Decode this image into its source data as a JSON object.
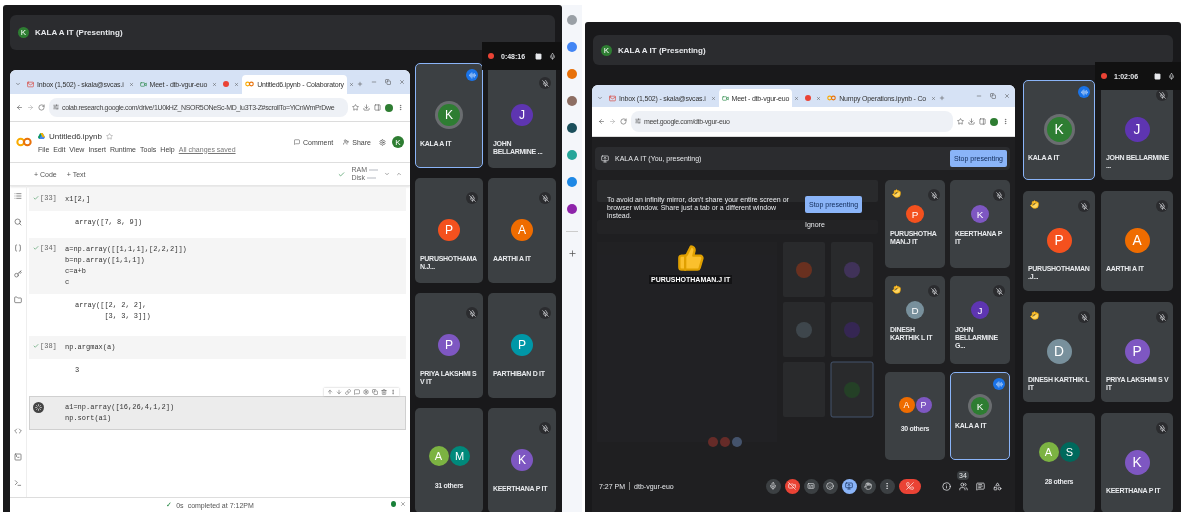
{
  "screens": [
    {
      "kind": "colab",
      "header": {
        "avatar": "K",
        "title": "KALA A IT (Presenting)"
      },
      "recording": {
        "time": "0:48:16"
      },
      "browser": {
        "tabs": [
          {
            "kind": "mail",
            "title": "Inbox (1,502) - skala@svcas.i",
            "selected": false
          },
          {
            "kind": "meet",
            "title": "Meet - dtb-vgur-euo",
            "selected": false
          },
          {
            "kind": "recording",
            "selected": false
          },
          {
            "kind": "colab",
            "title": "Untitled6.ipynb - Colaboratory",
            "selected": true
          }
        ],
        "url": "colab.research.google.com/drive/1U0kHZ_NSOR5ONeSc-MD_lu3T3-Z#scrollTo=YiCnWmPrDwe"
      },
      "notebook": {
        "name": "Untitled6.ipynb",
        "menu": [
          "File",
          "Edit",
          "View",
          "Insert",
          "Runtime",
          "Tools",
          "Help"
        ],
        "save_status": "All changes saved",
        "actions": [
          {
            "kind": "comment",
            "label": "Comment"
          },
          {
            "kind": "share",
            "label": "Share"
          }
        ],
        "avatar": "K",
        "toolbar": [
          "+ Code",
          "+ Text"
        ],
        "resources": [
          "RAM",
          "Disk"
        ],
        "cells": [
          {
            "number": "[33]",
            "active": false,
            "code": [
              "x1[2,]"
            ],
            "output": [
              "array([7, 8, 9])"
            ]
          },
          {
            "number": "[34]",
            "active": false,
            "code": [
              "a=np.array([[1,1,1],[2,2,2]])",
              "b=np.array([1,1,1])",
              "c=a+b",
              "c"
            ],
            "output": [
              "array([[2, 2, 2],",
              "       [3, 3, 3]])"
            ]
          },
          {
            "number": "[38]",
            "active": false,
            "code": [
              "np.argmax(a)"
            ],
            "output": [
              "3"
            ]
          },
          {
            "active": true,
            "code": [
              "a1=np.array([16,26,4,1,2])",
              "np.sort(a1)"
            ]
          }
        ],
        "status": {
          "check": "✓",
          "duration": "0s",
          "text": "completed at 7:12PM"
        }
      },
      "tiles": [
        {
          "kind": "person",
          "name": "KALA A IT",
          "initial": "K",
          "color": "#2e7d32",
          "speaking": true,
          "muted": false,
          "hand_raised": false
        },
        {
          "kind": "person",
          "name": "JOHN BELLARMINE ...",
          "initial": "J",
          "color": "#5e35b1",
          "speaking": false,
          "muted": true,
          "hand_raised": false
        },
        {
          "kind": "person",
          "name": "PURUSHOTHAMAN.J...",
          "initial": "P",
          "color": "#f4511e",
          "speaking": false,
          "muted": true,
          "hand_raised": false
        },
        {
          "kind": "person",
          "name": "AARTHI A IT",
          "initial": "A",
          "color": "#ef6c00",
          "speaking": false,
          "muted": true,
          "hand_raised": false
        },
        {
          "kind": "person",
          "name": "PRIYA LAKSHMI S V IT",
          "initial": "P",
          "color": "#7e57c2",
          "speaking": false,
          "muted": true,
          "hand_raised": false
        },
        {
          "kind": "person",
          "name": "PARTHIBAN D IT",
          "initial": "P",
          "color": "#0097a7",
          "speaking": false,
          "muted": true,
          "hand_raised": false
        },
        {
          "kind": "others",
          "label": "31 others",
          "avatars": [
            {
              "initial": "A",
              "color": "#7cb342"
            },
            {
              "initial": "M",
              "color": "#00897b"
            }
          ]
        },
        {
          "kind": "person",
          "name": "KEERTHANA P IT",
          "initial": "K",
          "color": "#7e57c2",
          "speaking": false,
          "muted": true,
          "hand_raised": false
        }
      ]
    },
    {
      "kind": "meet",
      "header": {
        "avatar": "K",
        "title": "KALA A IT (Presenting)"
      },
      "recording": {
        "time": "1:02:06"
      },
      "browser": {
        "tabs": [
          {
            "kind": "mail",
            "title": "Inbox (1,502) - skala@svcas.i",
            "selected": false
          },
          {
            "kind": "meet",
            "title": "Meet - dtb-vgur-euo",
            "selected": true
          },
          {
            "kind": "recording",
            "selected": false
          },
          {
            "kind": "colab",
            "title": "Numpy Operations.ipynb - Co",
            "selected": false
          }
        ],
        "url": "meet.google.com/dtb-vgur-euo"
      },
      "meet": {
        "presenter": "KALA A IT (You, presenting)",
        "stop_button": "Stop presenting",
        "notice": {
          "text": "To avoid an infinity mirror, don't share your entire screen or browser window. Share just a tab or a different window instead.",
          "button": "Stop presenting",
          "dismiss": "Ignore"
        },
        "reaction": {
          "name": "PURUSHOTHAMAN.J IT"
        },
        "tiles": [
          {
            "kind": "person",
            "name": "PURUSHOTHAMAN.J IT",
            "initial": "P",
            "color": "#f4511e",
            "speaking": false,
            "muted": true,
            "hand_raised": true
          },
          {
            "kind": "person",
            "name": "KEERTHANA P IT",
            "initial": "K",
            "color": "#7e57c2",
            "speaking": false,
            "muted": true,
            "hand_raised": false
          },
          {
            "kind": "person",
            "name": "DINESH KARTHIK L IT",
            "initial": "D",
            "color": "#78909c",
            "speaking": false,
            "muted": true,
            "hand_raised": true
          },
          {
            "kind": "person",
            "name": "JOHN BELLARMINE G...",
            "initial": "J",
            "color": "#5e35b1",
            "speaking": false,
            "muted": true,
            "hand_raised": false
          },
          {
            "kind": "others",
            "label": "30 others",
            "avatars": [
              {
                "initial": "A",
                "color": "#ef6c00"
              },
              {
                "initial": "P",
                "color": "#7e57c2"
              }
            ]
          },
          {
            "kind": "person",
            "name": "KALA A IT",
            "initial": "K",
            "color": "#2e7d32",
            "speaking": true,
            "muted": false,
            "hand_raised": false
          }
        ],
        "time": "7:27 PM",
        "meeting_code": "dtb-vgur-euo",
        "controls": [
          {
            "kind": "mic",
            "on": true
          },
          {
            "kind": "camera",
            "on": false
          },
          {
            "kind": "captions",
            "on": false
          },
          {
            "kind": "reactions"
          },
          {
            "kind": "present",
            "on": true
          },
          {
            "kind": "hand",
            "on": false
          },
          {
            "kind": "more"
          },
          {
            "kind": "leave"
          }
        ],
        "side_buttons": [
          {
            "kind": "info"
          },
          {
            "kind": "people",
            "badge": "34"
          },
          {
            "kind": "chat"
          },
          {
            "kind": "activities"
          }
        ]
      },
      "tiles": [
        {
          "kind": "person",
          "name": "KALA A IT",
          "initial": "K",
          "color": "#2e7d32",
          "speaking": true,
          "muted": false,
          "hand_raised": false
        },
        {
          "kind": "person",
          "name": "JOHN BELLARMINE ...",
          "initial": "J",
          "color": "#5e35b1",
          "speaking": false,
          "muted": true,
          "hand_raised": false
        },
        {
          "kind": "person",
          "name": "PURUSHOTHAMAN.J...",
          "initial": "P",
          "color": "#f4511e",
          "speaking": false,
          "muted": true,
          "hand_raised": true
        },
        {
          "kind": "person",
          "name": "AARTHI A IT",
          "initial": "A",
          "color": "#ef6c00",
          "speaking": false,
          "muted": true,
          "hand_raised": false
        },
        {
          "kind": "person",
          "name": "DINESH KARTHIK L IT",
          "initial": "D",
          "color": "#78909c",
          "speaking": false,
          "muted": true,
          "hand_raised": true
        },
        {
          "kind": "person",
          "name": "PRIYA LAKSHMI S V IT",
          "initial": "P",
          "color": "#7e57c2",
          "speaking": false,
          "muted": true,
          "hand_raised": false
        },
        {
          "kind": "others",
          "label": "28 others",
          "avatars": [
            {
              "initial": "A",
              "color": "#7cb342"
            },
            {
              "initial": "S",
              "color": "#00695c"
            }
          ]
        },
        {
          "kind": "person",
          "name": "KEERTHANA P IT",
          "initial": "K",
          "color": "#7e57c2",
          "speaking": false,
          "muted": true,
          "hand_raised": false
        }
      ]
    }
  ]
}
